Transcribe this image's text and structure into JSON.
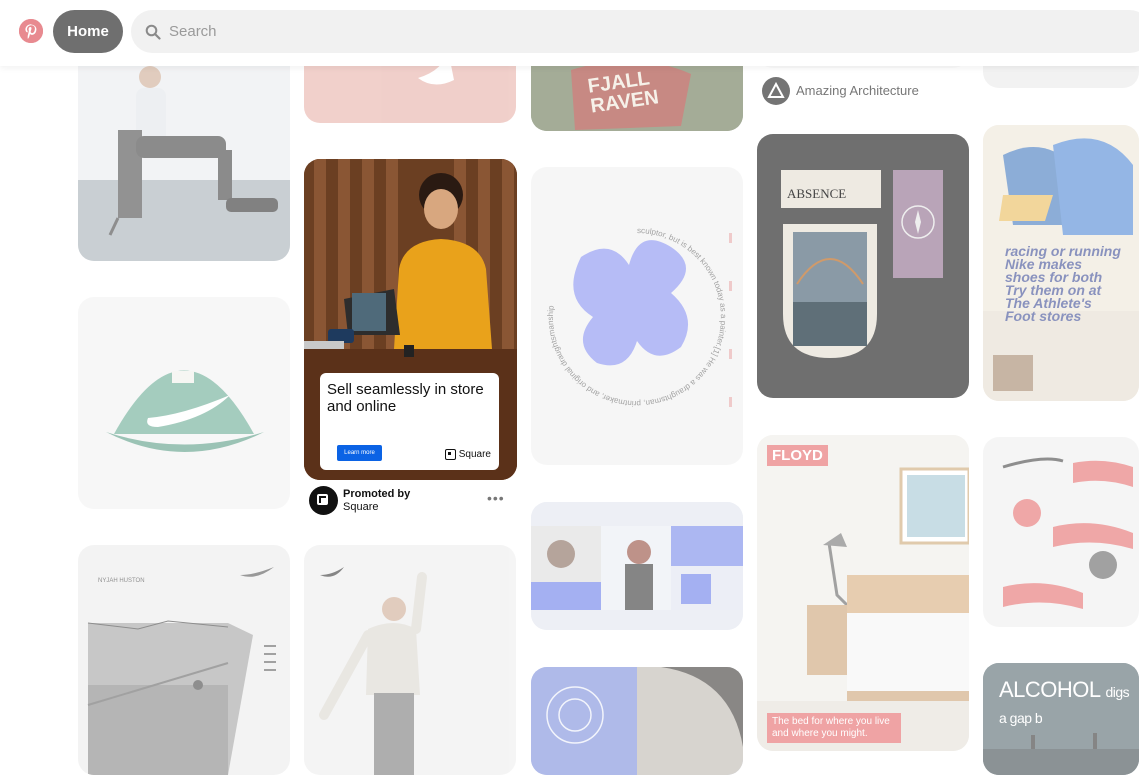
{
  "topbar": {
    "logo_icon": "pinterest-logo-icon",
    "home_label": "Home",
    "search_placeholder": "Search",
    "search_icon": "search-icon"
  },
  "pins": {
    "fjall": {
      "line1": "FJALL",
      "line2": "RAVEN"
    },
    "architecture_board": {
      "name": "Amazing Architecture"
    },
    "square_ad": {
      "headline": "Sell seamlessly in store and online",
      "cta": "Learn more",
      "brand": "Square",
      "promoted_label": "Promoted by",
      "promoter": "Square",
      "more_icon": "more-options-icon"
    },
    "painter_art": {
      "ring_text": "sculptor, but is best known today as a painter.[1] He was a draughtsman, printmaker, and original draughtsmanship"
    },
    "absence": {
      "title": "ABSENCE"
    },
    "nike_ad": {
      "headline": "racing or running Nike makes shoes for both Try them on at The Athlete's Foot stores"
    },
    "floyd": {
      "brand": "FLOYD",
      "caption": "The bed for where you live and where you might."
    },
    "alcohol": {
      "headline": "ALCOHOL",
      "sub": "digs a gap b"
    },
    "hiker_poster": {
      "name": "NYJAH HUSTON"
    }
  },
  "colors": {
    "pinterest_red": "#e60023",
    "home_bg": "#767676",
    "square_blue": "#0b63e5",
    "floyd_red": "#e2585a",
    "flower_blue": "#7b86f0"
  }
}
